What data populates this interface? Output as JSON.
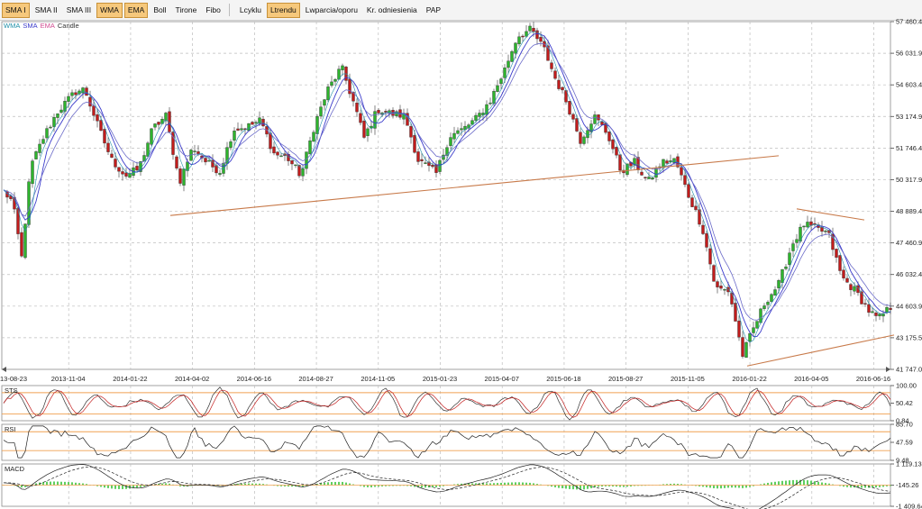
{
  "toolbar": {
    "items": [
      {
        "label": "SMA I",
        "active": true
      },
      {
        "label": "SMA II",
        "active": false
      },
      {
        "label": "SMA III",
        "active": false
      },
      {
        "label": "WMA",
        "active": true
      },
      {
        "label": "EMA",
        "active": true
      },
      {
        "label": "Boll",
        "active": false
      },
      {
        "label": "Tirone",
        "active": false
      },
      {
        "label": "Fibo",
        "active": false
      },
      {
        "label": "Lcyklu",
        "active": false,
        "sep_before": true
      },
      {
        "label": "Ltrendu",
        "active": true
      },
      {
        "label": "Lwparcia/oporu",
        "active": false
      },
      {
        "label": "Kr. odniesienia",
        "active": false
      },
      {
        "label": "PAP",
        "active": false
      }
    ]
  },
  "legend": [
    {
      "label": "WMA",
      "color": "#1e8fa8"
    },
    {
      "label": "SMA",
      "color": "#3a3acb"
    },
    {
      "label": "EMA",
      "color": "#d04a90"
    },
    {
      "label": "Candle",
      "color": "#333333"
    }
  ],
  "colors": {
    "up": "#2db52d",
    "down": "#c21c1c",
    "wma": "#1e8fa8",
    "sma": "#3a3acb",
    "ema": "#6a6ac8",
    "trend": "#c87a4a",
    "band": "#f0a050",
    "grid": "#bdbdbd",
    "macd_hist": "#5fcf5f"
  },
  "chart_data": [
    {
      "type": "candlestick",
      "title": "",
      "x_ticks": [
        "13-08-23",
        "2013-11-04",
        "2014-01-22",
        "2014-04-02",
        "2014-06-16",
        "2014-08-27",
        "2014-11-05",
        "2015-01-23",
        "2015-04-07",
        "2015-06-18",
        "2015-08-27",
        "2015-11-05",
        "2016-01-22",
        "2016-04-05",
        "2016-06-16"
      ],
      "y_ticks": [
        "57 460.4",
        "56 031.91",
        "54 603.42",
        "53 174.93",
        "51 746.44",
        "50 317.95",
        "48 889.46",
        "47 460.97",
        "46 032.48",
        "44 603.99",
        "43 175.5",
        "41 747.01"
      ],
      "ylim": [
        41747.01,
        57460.4
      ],
      "close_path": [
        [
          0,
          49800
        ],
        [
          10,
          49300
        ],
        [
          20,
          46800
        ],
        [
          30,
          50900
        ],
        [
          45,
          52300
        ],
        [
          60,
          53400
        ],
        [
          80,
          54300
        ],
        [
          90,
          54400
        ],
        [
          105,
          52700
        ],
        [
          120,
          51200
        ],
        [
          135,
          50500
        ],
        [
          150,
          50800
        ],
        [
          165,
          52600
        ],
        [
          180,
          53200
        ],
        [
          195,
          50200
        ],
        [
          210,
          51800
        ],
        [
          225,
          51100
        ],
        [
          240,
          50700
        ],
        [
          255,
          52600
        ],
        [
          270,
          52700
        ],
        [
          285,
          53000
        ],
        [
          300,
          51500
        ],
        [
          315,
          51300
        ],
        [
          330,
          50500
        ],
        [
          345,
          52800
        ],
        [
          360,
          54400
        ],
        [
          375,
          55400
        ],
        [
          390,
          53600
        ],
        [
          400,
          52200
        ],
        [
          415,
          53500
        ],
        [
          430,
          53300
        ],
        [
          445,
          53200
        ],
        [
          460,
          51200
        ],
        [
          470,
          50900
        ],
        [
          480,
          50600
        ],
        [
          495,
          52300
        ],
        [
          510,
          52600
        ],
        [
          525,
          53100
        ],
        [
          540,
          53900
        ],
        [
          555,
          55200
        ],
        [
          570,
          56800
        ],
        [
          585,
          57100
        ],
        [
          600,
          56200
        ],
        [
          612,
          54900
        ],
        [
          625,
          53800
        ],
        [
          640,
          52100
        ],
        [
          655,
          53200
        ],
        [
          670,
          52400
        ],
        [
          685,
          50700
        ],
        [
          700,
          51100
        ],
        [
          715,
          50200
        ],
        [
          730,
          51100
        ],
        [
          745,
          51200
        ],
        [
          760,
          49600
        ],
        [
          775,
          48200
        ],
        [
          790,
          45400
        ],
        [
          805,
          45300
        ],
        [
          820,
          42400
        ],
        [
          830,
          43400
        ],
        [
          845,
          44800
        ],
        [
          860,
          45600
        ],
        [
          875,
          47400
        ],
        [
          888,
          48300
        ],
        [
          900,
          48100
        ],
        [
          915,
          47900
        ],
        [
          930,
          45900
        ],
        [
          945,
          45300
        ],
        [
          960,
          44400
        ],
        [
          970,
          44000
        ],
        [
          985,
          44600
        ]
      ],
      "trend_lines": [
        {
          "points": [
            [
              185,
              48700
            ],
            [
              860,
              51400
            ]
          ]
        },
        {
          "points": [
            [
              880,
              49000
            ],
            [
              955,
              48500
            ]
          ]
        },
        {
          "points": [
            [
              825,
              41900
            ],
            [
              988,
              43300
            ]
          ]
        }
      ]
    },
    {
      "type": "line",
      "name": "STS",
      "y_ticks": [
        "100.00",
        "50.42",
        "0.84"
      ],
      "ylim": [
        0.84,
        100.0
      ],
      "bands": [
        80,
        20
      ]
    },
    {
      "type": "line",
      "name": "RSI",
      "y_ticks": [
        "85.70",
        "47.59",
        "9.48"
      ],
      "ylim": [
        9.48,
        85.7
      ],
      "bands": [
        70,
        30
      ]
    },
    {
      "type": "line",
      "name": "MACD",
      "y_ticks": [
        "1 119.13",
        "-145.26",
        "-1 409.64"
      ],
      "ylim": [
        -1409.64,
        1119.13
      ]
    }
  ]
}
